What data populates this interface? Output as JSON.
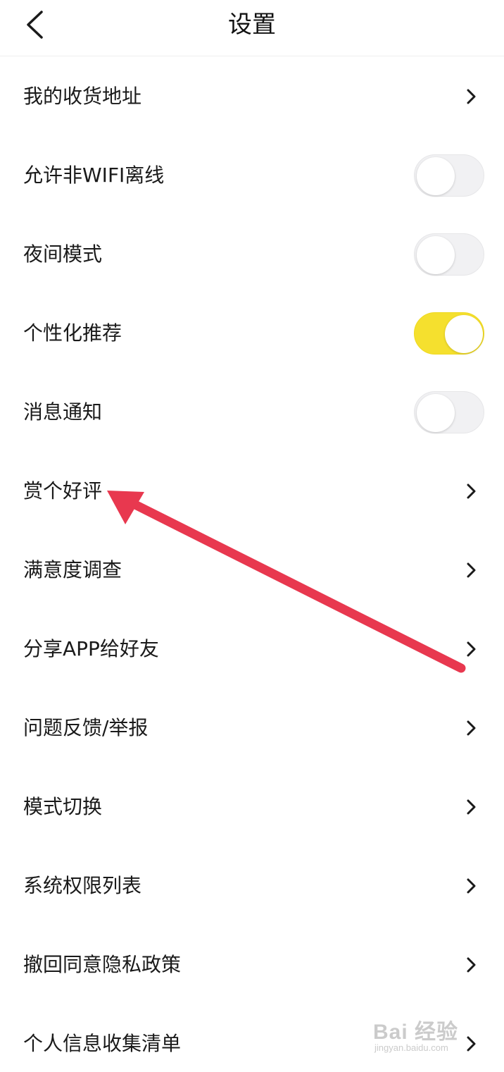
{
  "header": {
    "title": "设置"
  },
  "settings": {
    "rows": [
      {
        "label": "我的收货地址",
        "control": "chevron"
      },
      {
        "label": "允许非WIFI离线",
        "control": "toggle",
        "on": false
      },
      {
        "label": "夜间模式",
        "control": "toggle",
        "on": false
      },
      {
        "label": "个性化推荐",
        "control": "toggle",
        "on": true
      },
      {
        "label": "消息通知",
        "control": "toggle",
        "on": false
      },
      {
        "label": "赏个好评",
        "control": "chevron"
      },
      {
        "label": "满意度调查",
        "control": "chevron"
      },
      {
        "label": "分享APP给好友",
        "control": "chevron"
      },
      {
        "label": "问题反馈/举报",
        "control": "chevron"
      },
      {
        "label": "模式切换",
        "control": "chevron"
      },
      {
        "label": "系统权限列表",
        "control": "chevron"
      },
      {
        "label": "撤回同意隐私政策",
        "control": "chevron"
      },
      {
        "label": "个人信息收集清单",
        "control": "chevron"
      }
    ]
  },
  "colors": {
    "toggle_on": "#f5e02e",
    "toggle_off": "#f1f1f3",
    "annotation_arrow": "#e8384f"
  },
  "watermark": {
    "brand": "Bai 经验",
    "url": "jingyan.baidu.com"
  },
  "icons": {
    "back": "chevron-left-icon",
    "row_chevron": "chevron-right-icon",
    "annotation": "red-arrow-icon"
  }
}
